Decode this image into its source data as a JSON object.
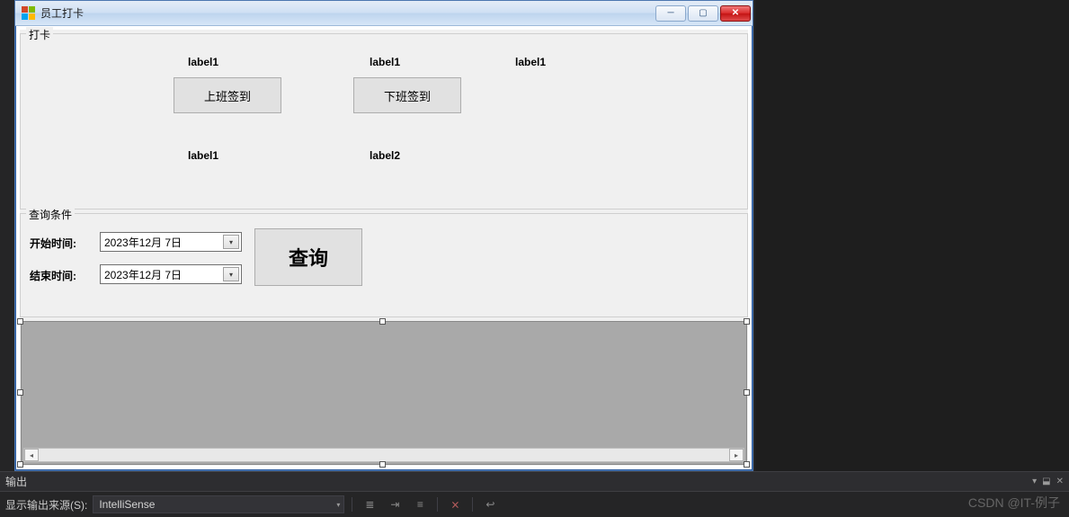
{
  "window": {
    "title": "员工打卡"
  },
  "group_punch": {
    "title": "打卡",
    "label_top_1": "label1",
    "label_top_2": "label1",
    "label_top_3": "label1",
    "btn_checkin": "上班签到",
    "btn_checkout": "下班签到",
    "label_bottom_1": "label1",
    "label_bottom_2": "label2"
  },
  "group_query": {
    "title": "查询条件",
    "start_label": "开始时间:",
    "end_label": "结束时间:",
    "start_value": "2023年12月  7日",
    "end_value": "2023年12月  7日",
    "btn_search": "查询"
  },
  "output": {
    "header": "输出",
    "source_label": "显示输出来源(S):",
    "source_value": "IntelliSense"
  },
  "watermark": "CSDN @IT-例子"
}
